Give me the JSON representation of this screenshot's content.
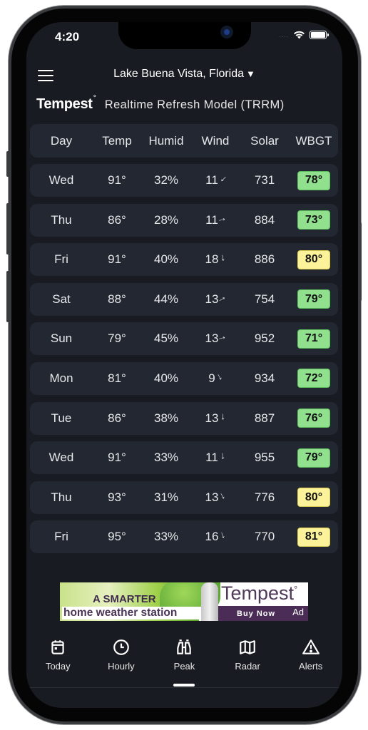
{
  "status_bar": {
    "time": "4:20",
    "signal": "....",
    "wifi_icon": "wifi-icon",
    "battery_icon": "battery-icon"
  },
  "header": {
    "location": "Lake Buena Vista, Florida",
    "caret": "▼",
    "menu_icon": "hamburger-menu-icon"
  },
  "brand": {
    "name": "Tempest",
    "degree_mark": "°",
    "model": "Realtime Refresh Model (TRRM)"
  },
  "table": {
    "columns": [
      "Day",
      "Temp",
      "Humid",
      "Wind",
      "Solar",
      "WBGT"
    ],
    "rows": [
      {
        "day": "Wed",
        "temp": "91°",
        "humid": "32%",
        "wind": "11",
        "wind_dir_deg": 225,
        "solar": "731",
        "wbgt": "78°",
        "wbgt_level": "green"
      },
      {
        "day": "Thu",
        "temp": "86°",
        "humid": "28%",
        "wind": "11",
        "wind_dir_deg": 75,
        "solar": "884",
        "wbgt": "73°",
        "wbgt_level": "green"
      },
      {
        "day": "Fri",
        "temp": "91°",
        "humid": "40%",
        "wind": "18",
        "wind_dir_deg": 170,
        "solar": "886",
        "wbgt": "80°",
        "wbgt_level": "yellow"
      },
      {
        "day": "Sat",
        "temp": "88°",
        "humid": "44%",
        "wind": "13",
        "wind_dir_deg": 60,
        "solar": "754",
        "wbgt": "79°",
        "wbgt_level": "green"
      },
      {
        "day": "Sun",
        "temp": "79°",
        "humid": "45%",
        "wind": "13",
        "wind_dir_deg": 75,
        "solar": "952",
        "wbgt": "71°",
        "wbgt_level": "green"
      },
      {
        "day": "Mon",
        "temp": "81°",
        "humid": "40%",
        "wind": "9",
        "wind_dir_deg": 150,
        "solar": "934",
        "wbgt": "72°",
        "wbgt_level": "green"
      },
      {
        "day": "Tue",
        "temp": "86°",
        "humid": "38%",
        "wind": "13",
        "wind_dir_deg": 180,
        "solar": "887",
        "wbgt": "76°",
        "wbgt_level": "green"
      },
      {
        "day": "Wed",
        "temp": "91°",
        "humid": "33%",
        "wind": "11",
        "wind_dir_deg": 175,
        "solar": "955",
        "wbgt": "79°",
        "wbgt_level": "green"
      },
      {
        "day": "Thu",
        "temp": "93°",
        "humid": "31%",
        "wind": "13",
        "wind_dir_deg": 150,
        "solar": "776",
        "wbgt": "80°",
        "wbgt_level": "yellow"
      },
      {
        "day": "Fri",
        "temp": "95°",
        "humid": "33%",
        "wind": "16",
        "wind_dir_deg": 160,
        "solar": "770",
        "wbgt": "81°",
        "wbgt_level": "yellow"
      }
    ]
  },
  "ad": {
    "line1": "A SMARTER",
    "line2": "home weather station",
    "brand": "Tempest",
    "cta": "Buy Now",
    "tag": "Ad"
  },
  "tabs": [
    {
      "label": "Today",
      "icon": "calendar-icon"
    },
    {
      "label": "Hourly",
      "icon": "clock-icon"
    },
    {
      "label": "Peak",
      "icon": "binoculars-icon",
      "active": true
    },
    {
      "label": "Radar",
      "icon": "map-icon"
    },
    {
      "label": "Alerts",
      "icon": "alert-triangle-icon"
    }
  ],
  "colors": {
    "background": "#181b21",
    "row": "#222731",
    "wbgt_green": "#90e08e",
    "wbgt_yellow": "#fbf29a"
  }
}
